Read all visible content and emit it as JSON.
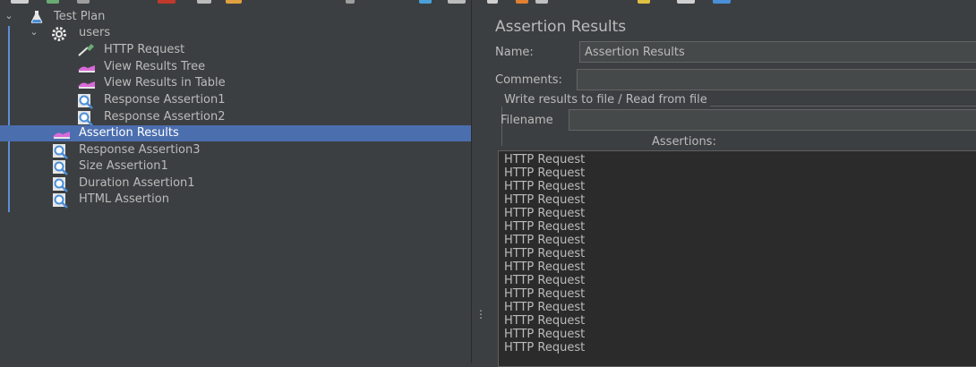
{
  "toolbar": {
    "icon_colors": [
      "#d0d0d0",
      "#6aab73",
      "#9e9e9e",
      "#c0392b",
      "#bbbbbb",
      "#e0a040",
      "#9e9e9e",
      "#4aa0d8",
      "#bbbbbb",
      "#d0d0d0",
      "#e08030",
      "#c0c0c0",
      "#e0c040",
      "#d0d0d0",
      "#4a8fd8"
    ]
  },
  "tree": {
    "items": [
      {
        "label": "Test Plan",
        "icon": "flask-icon"
      },
      {
        "label": "users",
        "icon": "gear-icon"
      },
      {
        "label": "HTTP Request",
        "icon": "pipette-icon"
      },
      {
        "label": "View Results Tree",
        "icon": "listener-icon"
      },
      {
        "label": "View Results in Table",
        "icon": "listener-icon"
      },
      {
        "label": "Response Assertion1",
        "icon": "magnifier-icon"
      },
      {
        "label": "Response Assertion2",
        "icon": "magnifier-icon"
      },
      {
        "label": "Assertion Results",
        "icon": "listener-icon"
      },
      {
        "label": "Response Assertion3",
        "icon": "magnifier-icon"
      },
      {
        "label": "Size Assertion1",
        "icon": "magnifier-icon"
      },
      {
        "label": "Duration Assertion1",
        "icon": "magnifier-icon"
      },
      {
        "label": "HTML Assertion",
        "icon": "magnifier-icon"
      }
    ],
    "selected_index": 7
  },
  "panel": {
    "title": "Assertion Results",
    "name_label": "Name:",
    "name_value": "Assertion Results",
    "comments_label": "Comments:",
    "comments_value": "",
    "file_group_title": "Write results to file / Read from file",
    "filename_label": "Filename",
    "filename_value": "",
    "assertions_label": "Assertions:",
    "results": [
      "HTTP Request",
      "HTTP Request",
      "HTTP Request",
      "HTTP Request",
      "HTTP Request",
      "HTTP Request",
      "HTTP Request",
      "HTTP Request",
      "HTTP Request",
      "HTTP Request",
      "HTTP Request",
      "HTTP Request",
      "HTTP Request",
      "HTTP Request",
      "HTTP Request"
    ]
  },
  "colors": {
    "selection": "#4b6eaf",
    "background": "#3c3f41",
    "text": "#bbbbbb"
  }
}
